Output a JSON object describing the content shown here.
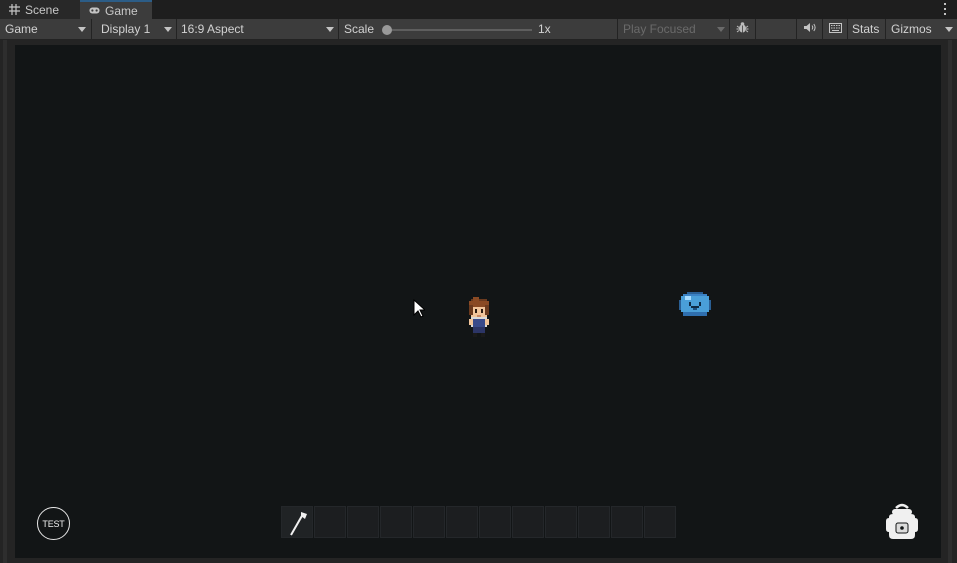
{
  "tabs": [
    {
      "label": "Scene",
      "icon": "grid-icon",
      "active": false
    },
    {
      "label": "Game",
      "icon": "gamepad-icon",
      "active": true
    }
  ],
  "toolbar": {
    "view_mode": "Game",
    "display": "Display 1",
    "aspect": "16:9 Aspect",
    "scale_label": "Scale",
    "scale_value": "1x",
    "scale_fraction": 0,
    "play_mode": "Play Focused",
    "stats_label": "Stats",
    "gizmos_label": "Gizmos"
  },
  "game": {
    "test_button_label": "TEST",
    "hotbar": {
      "slot_count": 12,
      "slots": [
        "axe-icon",
        "",
        "",
        "",
        "",
        "",
        "",
        "",
        "",
        "",
        "",
        ""
      ]
    },
    "entities": [
      "player-character",
      "blue-slime-enemy"
    ]
  },
  "colors": {
    "game_background": "#121516",
    "toolbar_background": "#3c3c3c",
    "active_tab_accent": "#2c5d87",
    "slime_blue": "#4a9fd8"
  }
}
